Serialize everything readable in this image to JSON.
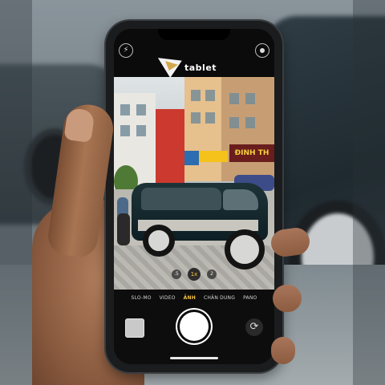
{
  "camera": {
    "brand_text": "tablet",
    "sign_text": "ĐINH TH",
    "zoom_levels": [
      ".5",
      "1x",
      "2"
    ],
    "active_zoom": "1x",
    "modes": [
      "SLO-MO",
      "VIDEO",
      "ẢNH",
      "CHÂN DUNG",
      "PANO"
    ],
    "active_mode": "ẢNH",
    "icons": {
      "flash": "flash-icon",
      "live": "live-photo-icon",
      "flip": "flip-camera-icon"
    },
    "colors": {
      "accent": "#f6c342",
      "phone_frame": "#1a1c1e",
      "screen_bg": "#0d0d0d"
    }
  }
}
